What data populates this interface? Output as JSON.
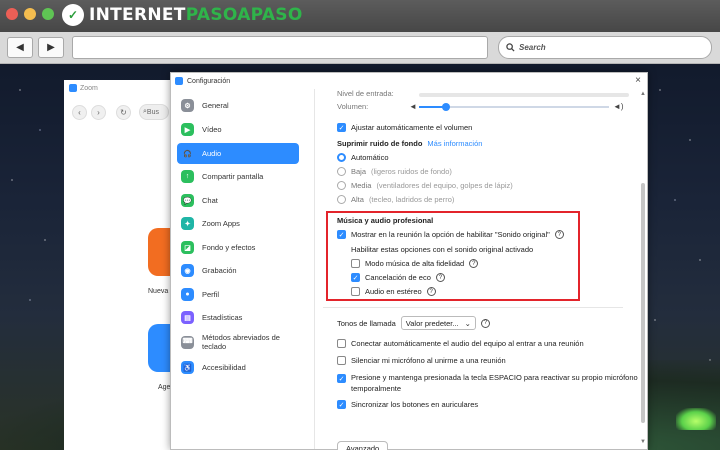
{
  "browser": {
    "logo_prefix": "INTERNET",
    "logo_highlight": "PASOAPASO",
    "search_placeholder": "Search"
  },
  "zoom_window": {
    "title": "Zoom",
    "search_label": "Bus",
    "tile1_label": "Nueva",
    "tile2_label": "Age"
  },
  "dialog": {
    "title": "Configuración",
    "close": "×"
  },
  "sidebar": {
    "items": [
      {
        "label": "General",
        "icon": "gear-icon",
        "color": "#8a8f98"
      },
      {
        "label": "Vídeo",
        "icon": "video-icon",
        "color": "#2cbf5e"
      },
      {
        "label": "Audio",
        "icon": "headphones-icon",
        "color": "#2d8cff",
        "active": true
      },
      {
        "label": "Compartir pantalla",
        "icon": "share-screen-icon",
        "color": "#2cbf5e"
      },
      {
        "label": "Chat",
        "icon": "chat-icon",
        "color": "#2cbf5e"
      },
      {
        "label": "Zoom Apps",
        "icon": "apps-icon",
        "color": "#1fb5a6"
      },
      {
        "label": "Fondo y efectos",
        "icon": "background-icon",
        "color": "#2cbf5e"
      },
      {
        "label": "Grabación",
        "icon": "record-icon",
        "color": "#2d8cff"
      },
      {
        "label": "Perfil",
        "icon": "profile-icon",
        "color": "#2d8cff"
      },
      {
        "label": "Estadísticas",
        "icon": "stats-icon",
        "color": "#7b61ff"
      },
      {
        "label": "Métodos abreviados de teclado",
        "icon": "keyboard-icon",
        "color": "#8a8f98"
      },
      {
        "label": "Accesibilidad",
        "icon": "accessibility-icon",
        "color": "#2d8cff"
      }
    ]
  },
  "audio": {
    "input_level_label": "Nivel de entrada:",
    "volume_label": "Volumen:",
    "volume_level": 0.14,
    "auto_volume_label": "Ajustar automáticamente el volumen",
    "noise_title": "Suprimir ruido de fondo",
    "noise_link": "Más información",
    "noise_options": {
      "auto": "Automático",
      "low": "Baja",
      "low_hint": "(ligeros ruidos de fondo)",
      "medium": "Media",
      "medium_hint": "(ventiladores del equipo, golpes de lápiz)",
      "high": "Alta",
      "high_hint": "(tecleo, ladridos de perro)"
    },
    "pro_title": "Música y audio profesional",
    "show_original_label": "Mostrar en la reunión la opción de habilitar \"Sonido original\"",
    "enable_with_original_label": "Habilitar estas opciones con el sonido original activado",
    "hifi_label": "Modo música de alta fidelidad",
    "echo_label": "Cancelación de eco",
    "stereo_label": "Audio en estéreo",
    "ringtone_label": "Tonos de llamada",
    "ringtone_value": "Valor predeter...",
    "auto_join_label": "Conectar automáticamente el audio del equipo al entrar a una reunión",
    "mute_label": "Silenciar mi micrófono al unirme a una reunión",
    "space_label_line1": "Presione y mantenga presionada la tecla ESPACIO para reactivar su propio micrófono",
    "space_label_line2": "temporalmente",
    "sync_label": "Sincronizar los botones en auriculares",
    "advanced_button": "Avanzado"
  }
}
